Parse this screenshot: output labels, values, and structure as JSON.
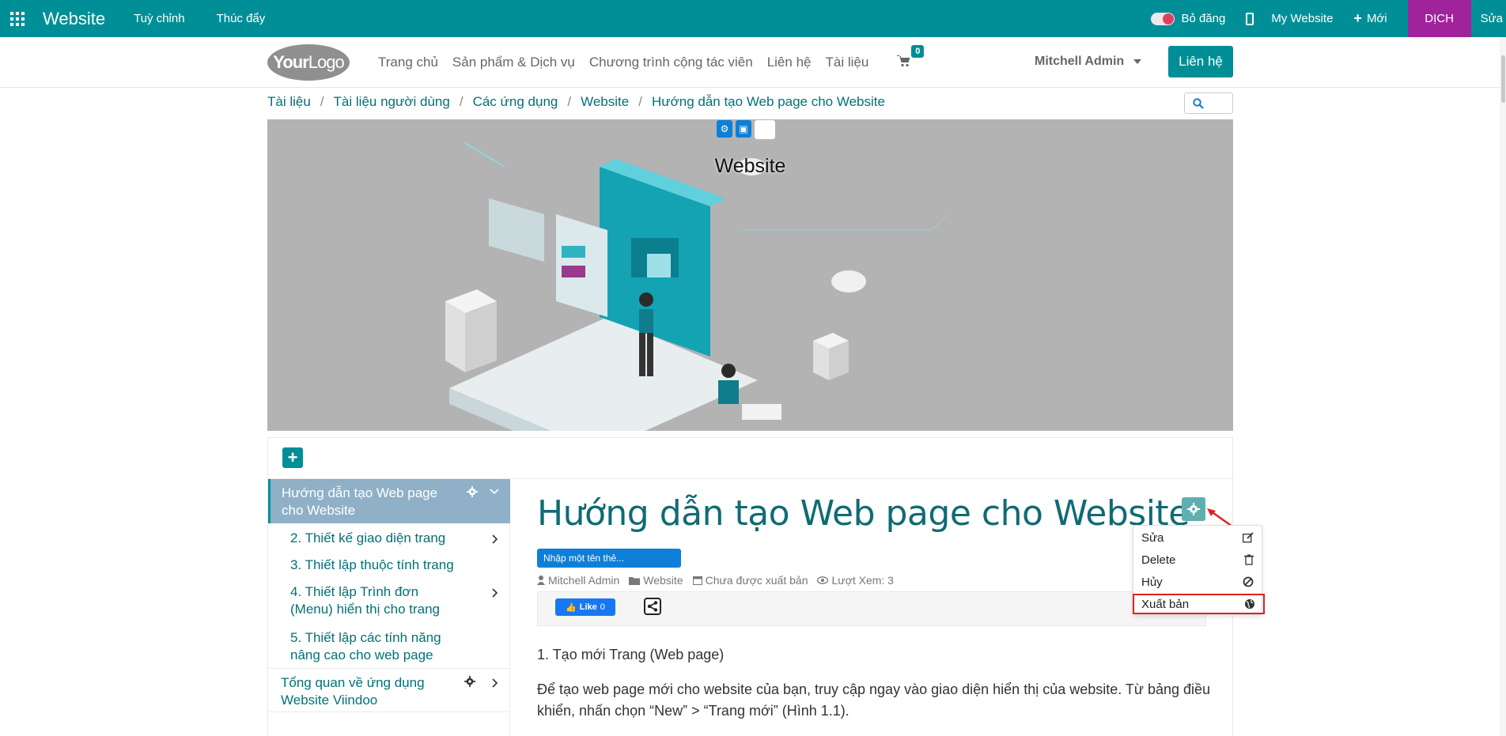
{
  "topbar": {
    "brand": "Website",
    "menu": [
      "Tuỳ chỉnh",
      "Thúc đẩy"
    ],
    "toggle_label": "Bỏ đăng",
    "my_website": "My Website",
    "new_label": "Mới",
    "translate": "DỊCH",
    "edit": "Sửa"
  },
  "header": {
    "logo_bold": "Your",
    "logo_light": "Logo",
    "nav": [
      "Trang chủ",
      "Sản phẩm & Dịch vụ",
      "Chương trình cộng tác viên",
      "Liên hệ",
      "Tài liệu"
    ],
    "cart_count": "0",
    "user": "Mitchell Admin",
    "contact_button": "Liên hệ"
  },
  "breadcrumb": [
    "Tài liệu",
    "Tài liệu người dùng",
    "Các ứng dụng",
    "Website",
    "Hướng dẫn tạo Web page cho Website"
  ],
  "cover": {
    "title": "Website"
  },
  "sidebar": {
    "active": "Hướng dẫn tạo Web page cho Website",
    "items": [
      "2. Thiết kế giao diện trang",
      "3. Thiết lập thuộc tính trang",
      "4. Thiết lập Trình đơn (Menu) hiển thị cho trang",
      "5. Thiết lập các tính năng nâng cao cho web page"
    ],
    "bottom": "Tổng quan về ứng dụng Website Viindoo"
  },
  "post": {
    "title": "Hướng dẫn tạo Web page cho Website",
    "tag_placeholder": "Nhập một tên thẻ...",
    "author": "Mitchell Admin",
    "category": "Website",
    "status": "Chưa được xuất bản",
    "views": "Lượt Xem: 3",
    "fb_like": "Like",
    "fb_count": "0",
    "heading1": "1. Tạo mới Trang (Web page)",
    "paragraph": "Để tạo web page mới cho website của bạn, truy cập ngay vào giao diện hiển thị của website. Từ bảng điều khiển, nhấn chọn “New” > “Trang mới” (Hình 1.1)."
  },
  "dropdown": {
    "items": [
      "Sửa",
      "Delete",
      "Hủy",
      "Xuất bản"
    ]
  },
  "colors": {
    "primary": "#018f97",
    "translate_bg": "#a1239c",
    "highlight": "#e02121"
  }
}
